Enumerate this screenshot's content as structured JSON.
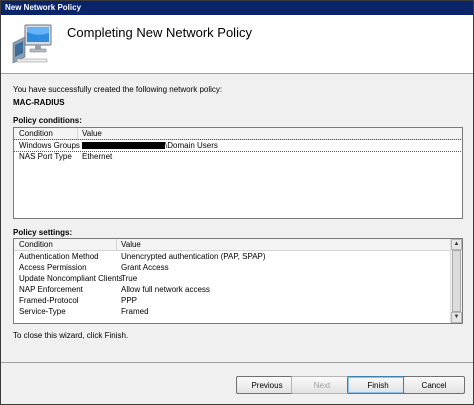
{
  "window": {
    "title": "New Network Policy"
  },
  "header": {
    "title": "Completing New Network Policy",
    "icon": "computer-network-icon"
  },
  "intro_text": "You have successfully created the following network policy:",
  "policy_name": "MAC-RADIUS",
  "conditions": {
    "label": "Policy conditions:",
    "columns": [
      "Condition",
      "Value"
    ],
    "rows": [
      {
        "condition": "Windows Groups",
        "value_suffix": "\\Domain Users"
      },
      {
        "condition": "NAS Port Type",
        "value": "Ethernet"
      }
    ]
  },
  "settings": {
    "label": "Policy settings:",
    "columns": [
      "Condition",
      "Value"
    ],
    "rows": [
      {
        "condition": "Authentication Method",
        "value": "Unencrypted authentication (PAP, SPAP)"
      },
      {
        "condition": "Access Permission",
        "value": "Grant Access"
      },
      {
        "condition": "Update Noncompliant Clients",
        "value": "True"
      },
      {
        "condition": "NAP Enforcement",
        "value": "Allow full network access"
      },
      {
        "condition": "Framed-Protocol",
        "value": "PPP"
      },
      {
        "condition": "Service-Type",
        "value": "Framed"
      }
    ]
  },
  "close_text": "To close this wizard, click Finish.",
  "buttons": {
    "previous": "Previous",
    "next": "Next",
    "finish": "Finish",
    "cancel": "Cancel"
  }
}
